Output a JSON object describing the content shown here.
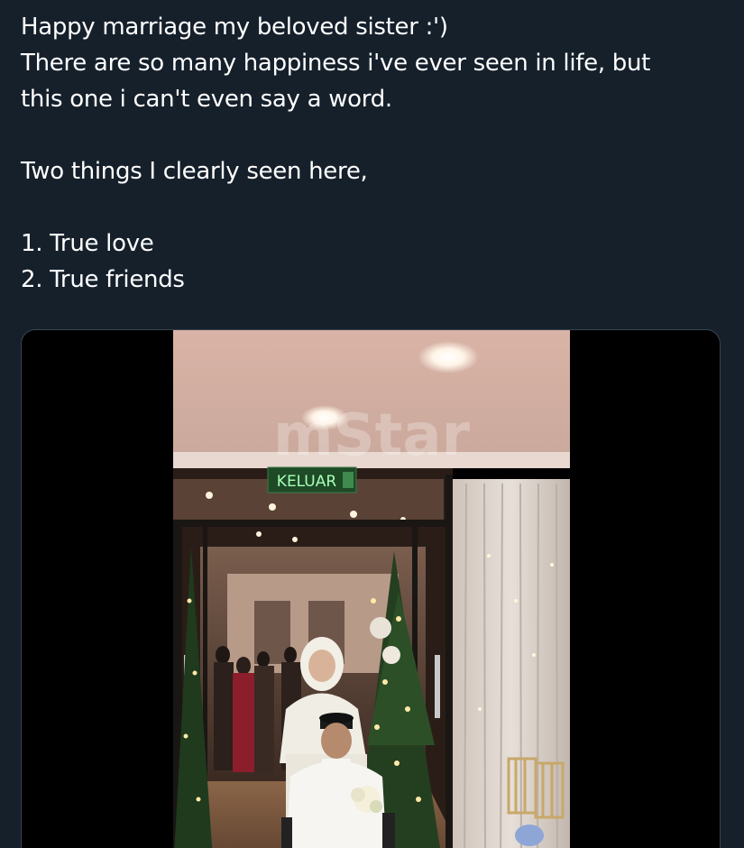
{
  "tweet": {
    "lines": [
      "Happy marriage my beloved sister :')",
      "There are so many happiness i've ever seen in life, but",
      "this one i can't even say a word.",
      "Two things I clearly seen here,",
      "1. True love",
      "2. True friends"
    ]
  },
  "media": {
    "watermark": "mStar",
    "exit_sign": "KELUAR"
  },
  "colors": {
    "background": "#15202b",
    "text": "#ffffff",
    "media_border": "#38444d"
  }
}
